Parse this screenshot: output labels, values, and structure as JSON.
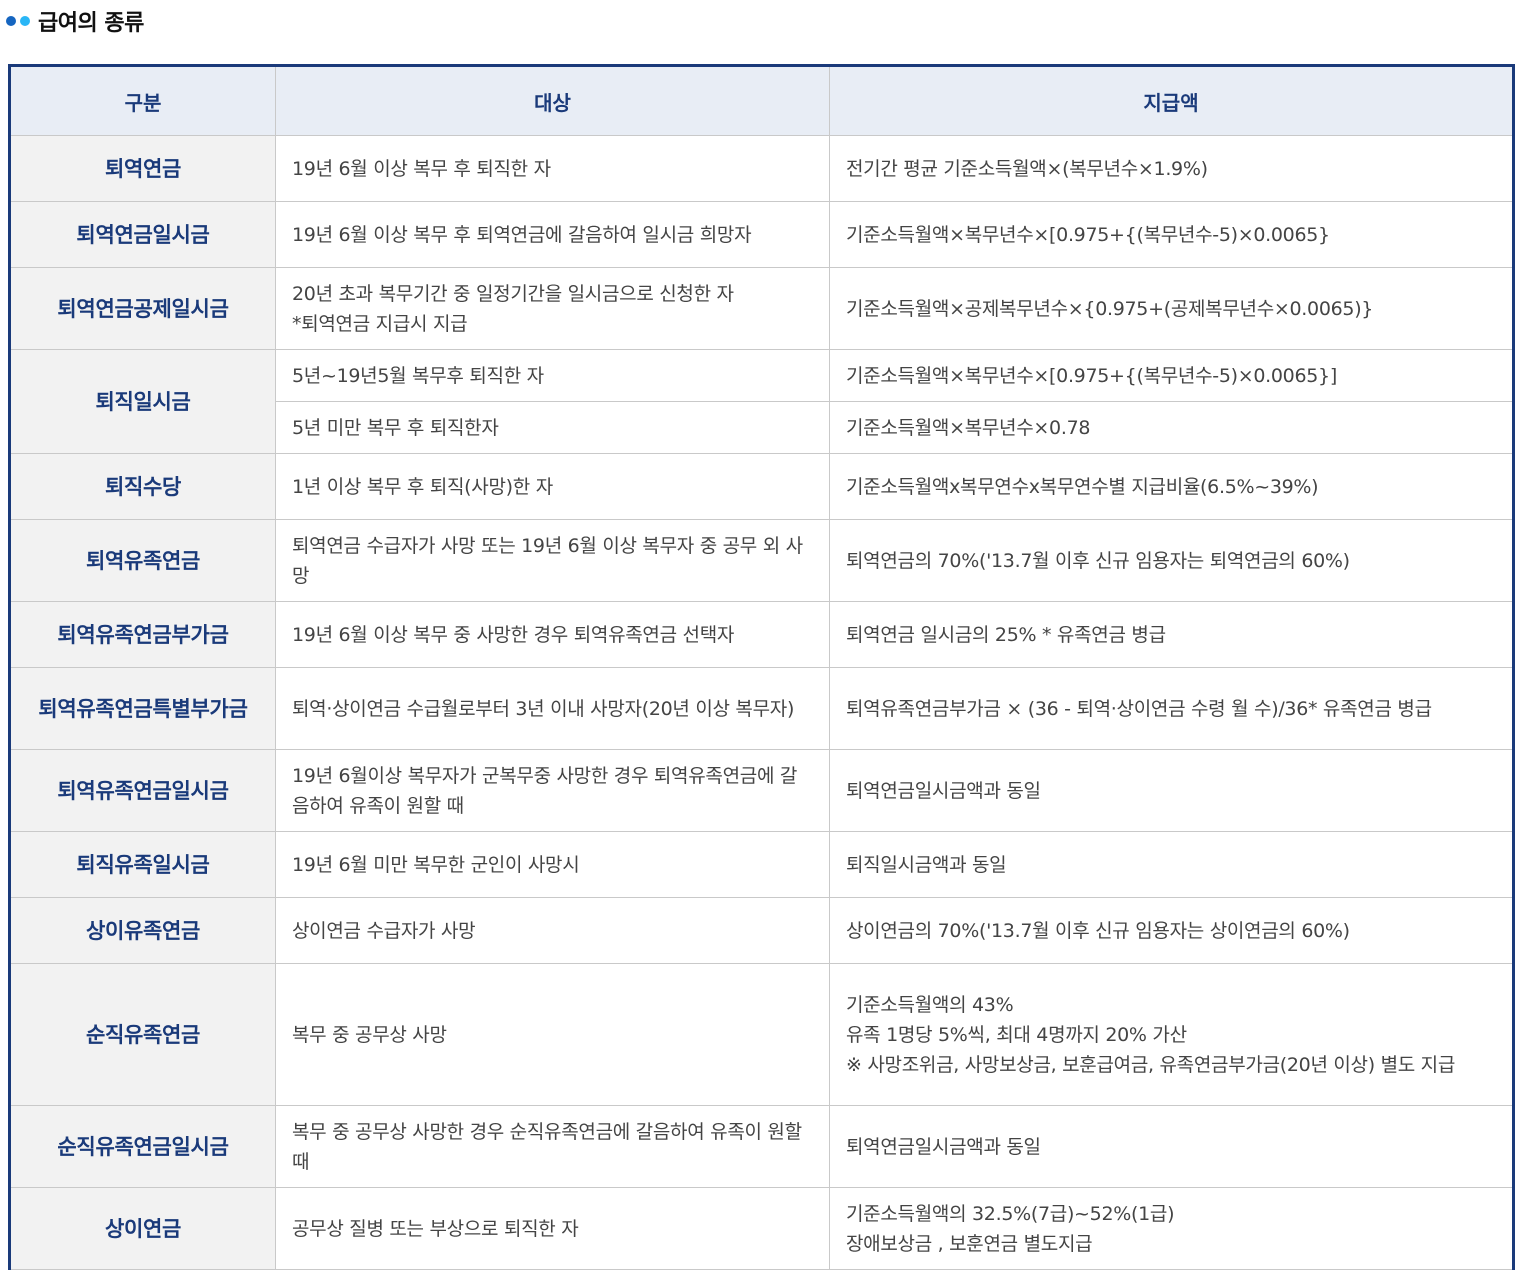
{
  "section": {
    "title": "급여의 종류"
  },
  "table": {
    "headers": [
      "구분",
      "대상",
      "지급액"
    ],
    "rows": [
      {
        "category": "퇴역연금",
        "target": "19년 6월 이상 복무 후 퇴직한 자",
        "amount": "전기간 평균 기준소득월액×(복무년수×1.9%)"
      },
      {
        "category": "퇴역연금일시금",
        "target": "19년 6월 이상 복무 후 퇴역연금에 갈음하여 일시금 희망자",
        "amount": "기준소득월액×복무년수×[0.975+{(복무년수-5)×0.0065}"
      },
      {
        "category": "퇴역연금공제일시금",
        "target": "20년 초과 복무기간 중 일정기간을 일시금으로 신청한 자\n*퇴역연금 지급시 지급",
        "amount": "기준소득월액×공제복무년수×{0.975+(공제복무년수×0.0065)}"
      },
      {
        "category": "퇴직일시금",
        "target": "5년~19년5월 복무후 퇴직한 자",
        "amount": "기준소득월액×복무년수×[0.975+{(복무년수-5)×0.0065}]"
      },
      {
        "target": "5년 미만 복무 후 퇴직한자",
        "amount": "기준소득월액×복무년수×0.78"
      },
      {
        "category": "퇴직수당",
        "target": "1년 이상 복무 후 퇴직(사망)한 자",
        "amount": "기준소득월액x복무연수x복무연수별 지급비율(6.5%~39%)"
      },
      {
        "category": "퇴역유족연금",
        "target": "퇴역연금 수급자가 사망 또는 19년 6월 이상 복무자 중 공무 외 사망",
        "amount": "퇴역연금의 70%('13.7월 이후 신규 임용자는 퇴역연금의 60%)"
      },
      {
        "category": "퇴역유족연금부가금",
        "target": "19년 6월 이상 복무 중 사망한 경우 퇴역유족연금 선택자",
        "amount": "퇴역연금 일시금의 25% * 유족연금 병급"
      },
      {
        "category": "퇴역유족연금특별부가금",
        "target": "퇴역·상이연금 수급월로부터 3년 이내 사망자(20년 이상 복무자)",
        "amount": "퇴역유족연금부가금 × (36 - 퇴역·상이연금 수령 월 수)/36* 유족연금 병급"
      },
      {
        "category": "퇴역유족연금일시금",
        "target": "19년 6월이상 복무자가 군복무중 사망한 경우 퇴역유족연금에 갈음하여 유족이 원할 때",
        "amount": "퇴역연금일시금액과 동일"
      },
      {
        "category": "퇴직유족일시금",
        "target": "19년 6월 미만 복무한 군인이 사망시",
        "amount": "퇴직일시금액과 동일"
      },
      {
        "category": "상이유족연금",
        "target": "상이연금 수급자가 사망",
        "amount": "상이연금의 70%('13.7월 이후 신규 임용자는 상이연금의 60%)"
      },
      {
        "category": "순직유족연금",
        "target": "복무 중 공무상 사망",
        "amount": "기준소득월액의 43%\n유족 1명당 5%씩, 최대 4명까지 20% 가산\n※ 사망조위금, 사망보상금, 보훈급여금, 유족연금부가금(20년 이상) 별도 지급"
      },
      {
        "category": "순직유족연금일시금",
        "target": "복무 중 공무상 사망한 경우 순직유족연금에 갈음하여 유족이 원할때",
        "amount": "퇴역연금일시금액과 동일"
      },
      {
        "category": "상이연금",
        "target": "공무상 질병 또는 부상으로 퇴직한 자",
        "amount": "기준소득월액의 32.5%(7급)~52%(1급)\n장애보상금 , 보훈연금 별도지급"
      }
    ]
  }
}
